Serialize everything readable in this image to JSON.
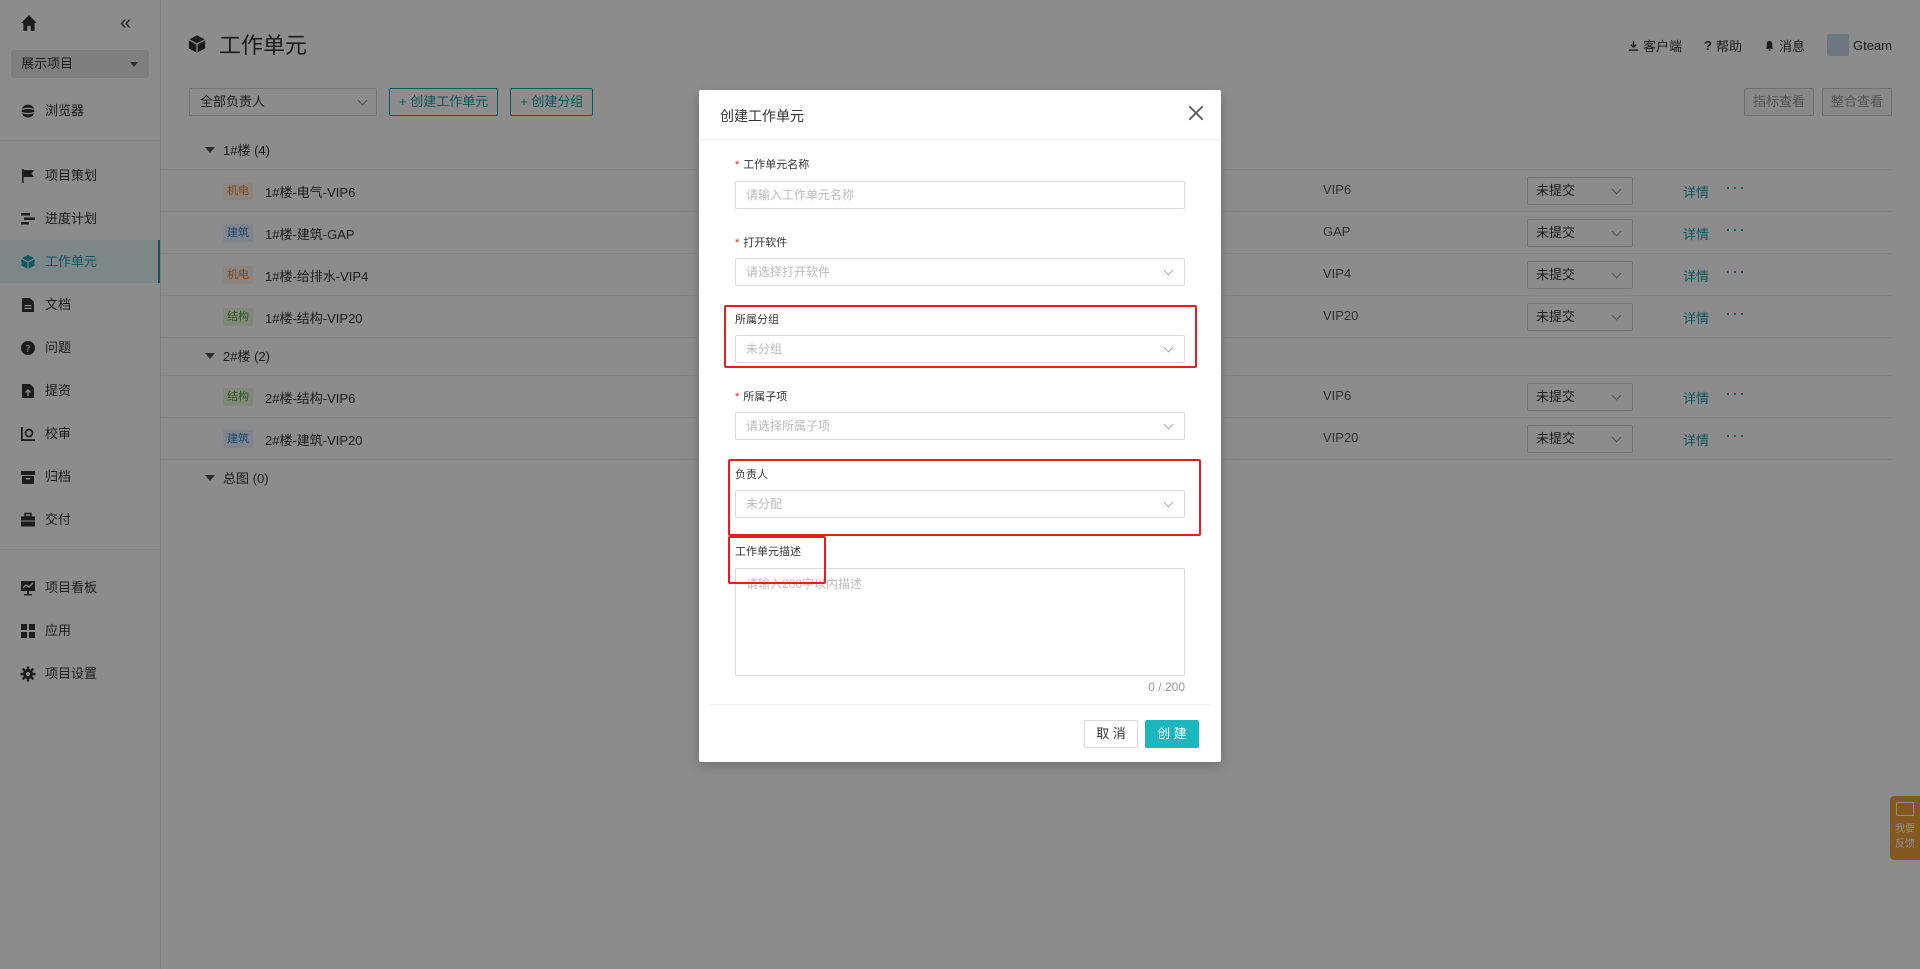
{
  "sidebar": {
    "project": "展示项目",
    "items": [
      {
        "label": "浏览器",
        "icon": "browser-icon"
      },
      {
        "label": "项目策划",
        "icon": "flag-icon"
      },
      {
        "label": "进度计划",
        "icon": "schedule-icon"
      },
      {
        "label": "工作单元",
        "icon": "cube-icon",
        "active": true
      },
      {
        "label": "文档",
        "icon": "document-icon"
      },
      {
        "label": "问题",
        "icon": "question-icon"
      },
      {
        "label": "提资",
        "icon": "submit-icon"
      },
      {
        "label": "校审",
        "icon": "review-icon"
      },
      {
        "label": "归档",
        "icon": "archive-icon"
      },
      {
        "label": "交付",
        "icon": "briefcase-icon"
      },
      {
        "label": "项目看板",
        "icon": "dashboard-icon"
      },
      {
        "label": "应用",
        "icon": "apps-icon"
      },
      {
        "label": "项目设置",
        "icon": "gear-icon"
      }
    ]
  },
  "header": {
    "title": "工作单元",
    "client": "客户端",
    "help": "帮助",
    "messages": "消息",
    "user": "Gteam"
  },
  "toolbar": {
    "owner_filter": "全部负责人",
    "create_unit": "+ 创建工作单元",
    "create_group": "+ 创建分组",
    "btn_metrics": "指标查看",
    "btn_merge": "整合查看"
  },
  "tree": {
    "groups": [
      {
        "label": "1#楼",
        "count": "(4)",
        "rows": [
          {
            "tag": "机电",
            "tag_type": "jd",
            "name": "1#楼-电气-VIP6",
            "version": "VIP6",
            "status": "未提交"
          },
          {
            "tag": "建筑",
            "tag_type": "jz",
            "name": "1#楼-建筑-GAP",
            "version": "GAP",
            "status": "未提交"
          },
          {
            "tag": "机电",
            "tag_type": "jd",
            "name": "1#楼-给排水-VIP4",
            "version": "VIP4",
            "status": "未提交"
          },
          {
            "tag": "结构",
            "tag_type": "jg",
            "name": "1#楼-结构-VIP20",
            "version": "VIP20",
            "status": "未提交"
          }
        ]
      },
      {
        "label": "2#楼",
        "count": "(2)",
        "rows": [
          {
            "tag": "结构",
            "tag_type": "jg",
            "name": "2#楼-结构-VIP6",
            "version": "VIP6",
            "status": "未提交"
          },
          {
            "tag": "建筑",
            "tag_type": "jz",
            "name": "2#楼-建筑-VIP20",
            "version": "VIP20",
            "status": "未提交"
          }
        ]
      },
      {
        "label": "总图",
        "count": "(0)",
        "rows": []
      }
    ],
    "detail_label": "详情",
    "more_label": "···"
  },
  "feedback": {
    "line1": "我要",
    "line2": "反馈"
  },
  "modal": {
    "title": "创建工作单元",
    "fields": {
      "name_label": "工作单元名称",
      "name_placeholder": "请输入工作单元名称",
      "software_label": "打开软件",
      "software_placeholder": "请选择打开软件",
      "group_label": "所属分组",
      "group_value": "未分组",
      "subitem_label": "所属子项",
      "subitem_placeholder": "请选择所属子项",
      "owner_label": "负责人",
      "owner_value": "未分配",
      "desc_label": "工作单元描述",
      "desc_placeholder": "请输入200字以内描述",
      "counter": "0 / 200"
    },
    "cancel": "取 消",
    "create": "创 建"
  },
  "colors": {
    "accent": "#1aa1a9",
    "highlight": "#e02020",
    "primary_btn": "#1ab7bf"
  }
}
